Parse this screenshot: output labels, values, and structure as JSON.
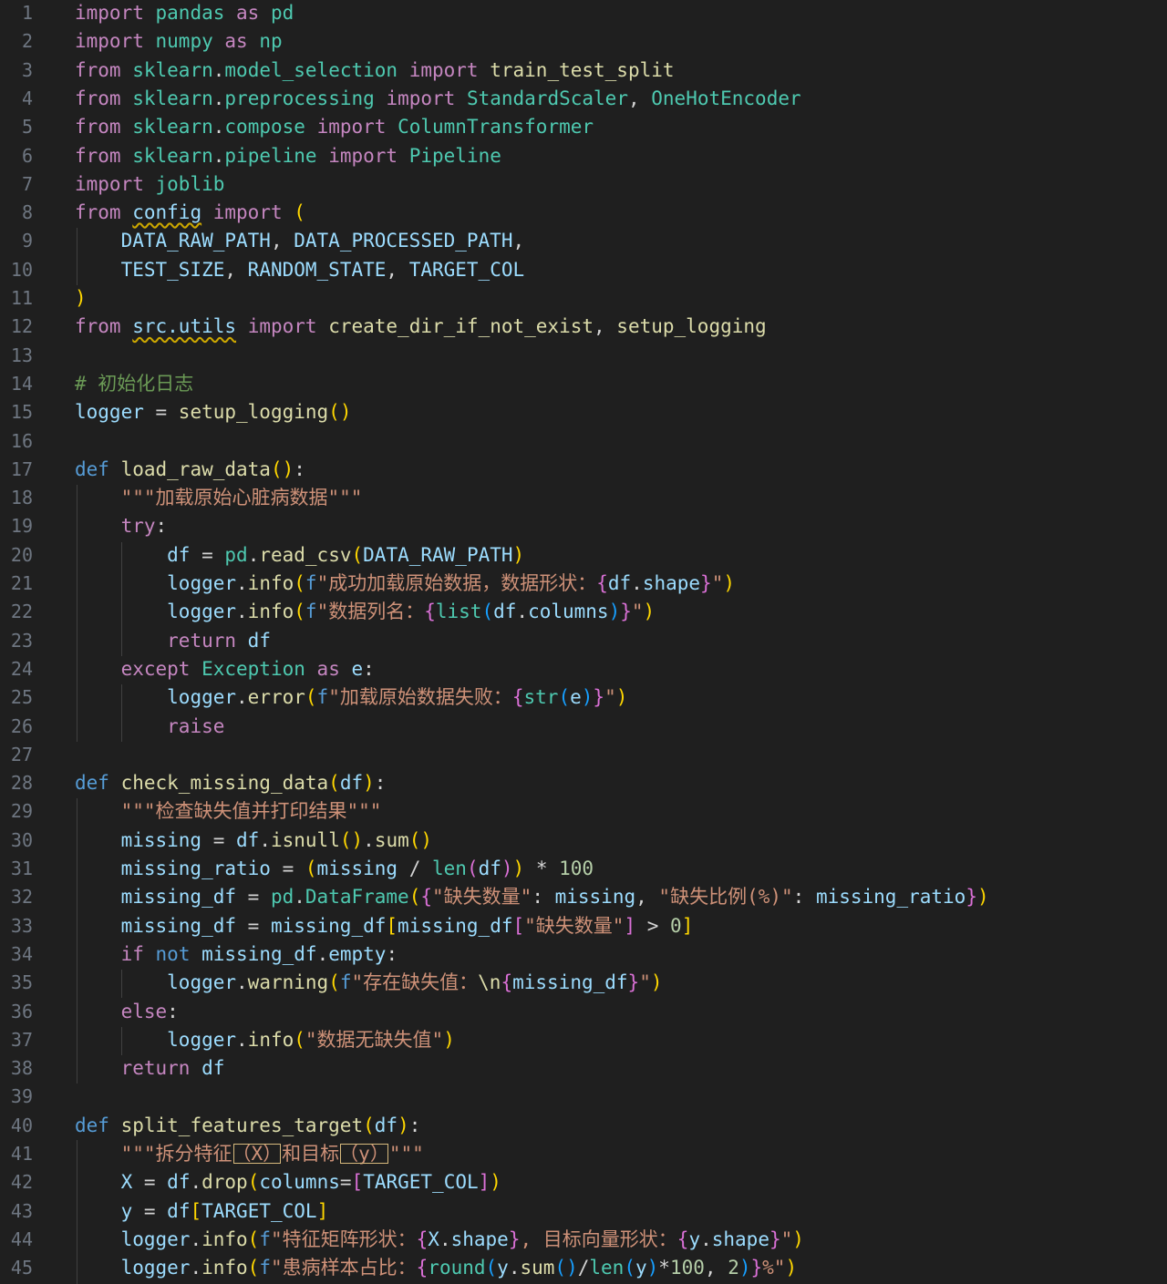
{
  "editor": {
    "language": "python",
    "lines": [
      {
        "n": "1",
        "code": "import pandas as pd"
      },
      {
        "n": "2",
        "code": "import numpy as np"
      },
      {
        "n": "3",
        "code": "from sklearn.model_selection import train_test_split"
      },
      {
        "n": "4",
        "code": "from sklearn.preprocessing import StandardScaler, OneHotEncoder"
      },
      {
        "n": "5",
        "code": "from sklearn.compose import ColumnTransformer"
      },
      {
        "n": "6",
        "code": "from sklearn.pipeline import Pipeline"
      },
      {
        "n": "7",
        "code": "import joblib"
      },
      {
        "n": "8",
        "code": "from config import ("
      },
      {
        "n": "9",
        "code": "    DATA_RAW_PATH, DATA_PROCESSED_PATH,"
      },
      {
        "n": "10",
        "code": "    TEST_SIZE, RANDOM_STATE, TARGET_COL"
      },
      {
        "n": "11",
        "code": ")"
      },
      {
        "n": "12",
        "code": "from src.utils import create_dir_if_not_exist, setup_logging"
      },
      {
        "n": "13",
        "code": ""
      },
      {
        "n": "14",
        "code": "# 初始化日志"
      },
      {
        "n": "15",
        "code": "logger = setup_logging()"
      },
      {
        "n": "16",
        "code": ""
      },
      {
        "n": "17",
        "code": "def load_raw_data():"
      },
      {
        "n": "18",
        "code": "    \"\"\"加载原始心脏病数据\"\"\""
      },
      {
        "n": "19",
        "code": "    try:"
      },
      {
        "n": "20",
        "code": "        df = pd.read_csv(DATA_RAW_PATH)"
      },
      {
        "n": "21",
        "code": "        logger.info(f\"成功加载原始数据，数据形状：{df.shape}\")"
      },
      {
        "n": "22",
        "code": "        logger.info(f\"数据列名：{list(df.columns)}\")"
      },
      {
        "n": "23",
        "code": "        return df"
      },
      {
        "n": "24",
        "code": "    except Exception as e:"
      },
      {
        "n": "25",
        "code": "        logger.error(f\"加载原始数据失败：{str(e)}\")"
      },
      {
        "n": "26",
        "code": "        raise"
      },
      {
        "n": "27",
        "code": ""
      },
      {
        "n": "28",
        "code": "def check_missing_data(df):"
      },
      {
        "n": "29",
        "code": "    \"\"\"检查缺失值并打印结果\"\"\""
      },
      {
        "n": "30",
        "code": "    missing = df.isnull().sum()"
      },
      {
        "n": "31",
        "code": "    missing_ratio = (missing / len(df)) * 100"
      },
      {
        "n": "32",
        "code": "    missing_df = pd.DataFrame({\"缺失数量\": missing, \"缺失比例(%)\": missing_ratio})"
      },
      {
        "n": "33",
        "code": "    missing_df = missing_df[missing_df[\"缺失数量\"] > 0]"
      },
      {
        "n": "34",
        "code": "    if not missing_df.empty:"
      },
      {
        "n": "35",
        "code": "        logger.warning(f\"存在缺失值：\\n{missing_df}\")"
      },
      {
        "n": "36",
        "code": "    else:"
      },
      {
        "n": "37",
        "code": "        logger.info(\"数据无缺失值\")"
      },
      {
        "n": "38",
        "code": "    return df"
      },
      {
        "n": "39",
        "code": ""
      },
      {
        "n": "40",
        "code": "def split_features_target(df):"
      },
      {
        "n": "41",
        "code": "    \"\"\"拆分特征（X）和目标（y）\"\"\""
      },
      {
        "n": "42",
        "code": "    X = df.drop(columns=[TARGET_COL])"
      },
      {
        "n": "43",
        "code": "    y = df[TARGET_COL]"
      },
      {
        "n": "44",
        "code": "    logger.info(f\"特征矩阵形状：{X.shape}, 目标向量形状：{y.shape}\")"
      },
      {
        "n": "45",
        "code": "    logger.info(f\"患病样本占比：{round(y.sum()/len(y)*100, 2)}%\")"
      }
    ]
  },
  "colors": {
    "background": "#1f1f1f",
    "line_number": "#6e7681",
    "keyword_import": "#c586c0",
    "keyword_def": "#569cd6",
    "function": "#dcdcaa",
    "class": "#4ec9b0",
    "variable": "#9cdcfe",
    "string": "#ce9178",
    "number": "#b5cea8",
    "comment": "#6a9955",
    "warning_squiggle": "#cca700"
  }
}
